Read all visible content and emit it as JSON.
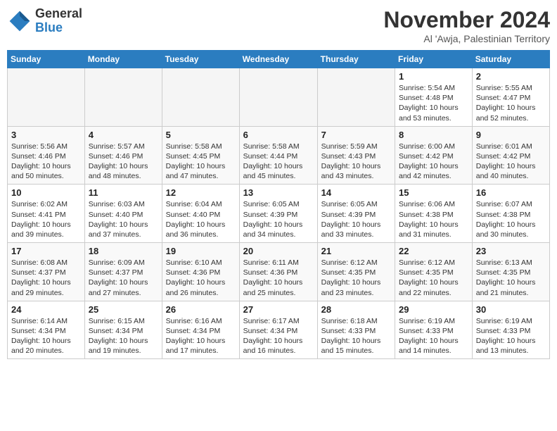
{
  "logo": {
    "line1": "General",
    "line2": "Blue"
  },
  "title": "November 2024",
  "location": "Al 'Awja, Palestinian Territory",
  "days_header": [
    "Sunday",
    "Monday",
    "Tuesday",
    "Wednesday",
    "Thursday",
    "Friday",
    "Saturday"
  ],
  "weeks": [
    [
      {
        "day": "",
        "info": ""
      },
      {
        "day": "",
        "info": ""
      },
      {
        "day": "",
        "info": ""
      },
      {
        "day": "",
        "info": ""
      },
      {
        "day": "",
        "info": ""
      },
      {
        "day": "1",
        "info": "Sunrise: 5:54 AM\nSunset: 4:48 PM\nDaylight: 10 hours\nand 53 minutes."
      },
      {
        "day": "2",
        "info": "Sunrise: 5:55 AM\nSunset: 4:47 PM\nDaylight: 10 hours\nand 52 minutes."
      }
    ],
    [
      {
        "day": "3",
        "info": "Sunrise: 5:56 AM\nSunset: 4:46 PM\nDaylight: 10 hours\nand 50 minutes."
      },
      {
        "day": "4",
        "info": "Sunrise: 5:57 AM\nSunset: 4:46 PM\nDaylight: 10 hours\nand 48 minutes."
      },
      {
        "day": "5",
        "info": "Sunrise: 5:58 AM\nSunset: 4:45 PM\nDaylight: 10 hours\nand 47 minutes."
      },
      {
        "day": "6",
        "info": "Sunrise: 5:58 AM\nSunset: 4:44 PM\nDaylight: 10 hours\nand 45 minutes."
      },
      {
        "day": "7",
        "info": "Sunrise: 5:59 AM\nSunset: 4:43 PM\nDaylight: 10 hours\nand 43 minutes."
      },
      {
        "day": "8",
        "info": "Sunrise: 6:00 AM\nSunset: 4:42 PM\nDaylight: 10 hours\nand 42 minutes."
      },
      {
        "day": "9",
        "info": "Sunrise: 6:01 AM\nSunset: 4:42 PM\nDaylight: 10 hours\nand 40 minutes."
      }
    ],
    [
      {
        "day": "10",
        "info": "Sunrise: 6:02 AM\nSunset: 4:41 PM\nDaylight: 10 hours\nand 39 minutes."
      },
      {
        "day": "11",
        "info": "Sunrise: 6:03 AM\nSunset: 4:40 PM\nDaylight: 10 hours\nand 37 minutes."
      },
      {
        "day": "12",
        "info": "Sunrise: 6:04 AM\nSunset: 4:40 PM\nDaylight: 10 hours\nand 36 minutes."
      },
      {
        "day": "13",
        "info": "Sunrise: 6:05 AM\nSunset: 4:39 PM\nDaylight: 10 hours\nand 34 minutes."
      },
      {
        "day": "14",
        "info": "Sunrise: 6:05 AM\nSunset: 4:39 PM\nDaylight: 10 hours\nand 33 minutes."
      },
      {
        "day": "15",
        "info": "Sunrise: 6:06 AM\nSunset: 4:38 PM\nDaylight: 10 hours\nand 31 minutes."
      },
      {
        "day": "16",
        "info": "Sunrise: 6:07 AM\nSunset: 4:38 PM\nDaylight: 10 hours\nand 30 minutes."
      }
    ],
    [
      {
        "day": "17",
        "info": "Sunrise: 6:08 AM\nSunset: 4:37 PM\nDaylight: 10 hours\nand 29 minutes."
      },
      {
        "day": "18",
        "info": "Sunrise: 6:09 AM\nSunset: 4:37 PM\nDaylight: 10 hours\nand 27 minutes."
      },
      {
        "day": "19",
        "info": "Sunrise: 6:10 AM\nSunset: 4:36 PM\nDaylight: 10 hours\nand 26 minutes."
      },
      {
        "day": "20",
        "info": "Sunrise: 6:11 AM\nSunset: 4:36 PM\nDaylight: 10 hours\nand 25 minutes."
      },
      {
        "day": "21",
        "info": "Sunrise: 6:12 AM\nSunset: 4:35 PM\nDaylight: 10 hours\nand 23 minutes."
      },
      {
        "day": "22",
        "info": "Sunrise: 6:12 AM\nSunset: 4:35 PM\nDaylight: 10 hours\nand 22 minutes."
      },
      {
        "day": "23",
        "info": "Sunrise: 6:13 AM\nSunset: 4:35 PM\nDaylight: 10 hours\nand 21 minutes."
      }
    ],
    [
      {
        "day": "24",
        "info": "Sunrise: 6:14 AM\nSunset: 4:34 PM\nDaylight: 10 hours\nand 20 minutes."
      },
      {
        "day": "25",
        "info": "Sunrise: 6:15 AM\nSunset: 4:34 PM\nDaylight: 10 hours\nand 19 minutes."
      },
      {
        "day": "26",
        "info": "Sunrise: 6:16 AM\nSunset: 4:34 PM\nDaylight: 10 hours\nand 17 minutes."
      },
      {
        "day": "27",
        "info": "Sunrise: 6:17 AM\nSunset: 4:34 PM\nDaylight: 10 hours\nand 16 minutes."
      },
      {
        "day": "28",
        "info": "Sunrise: 6:18 AM\nSunset: 4:33 PM\nDaylight: 10 hours\nand 15 minutes."
      },
      {
        "day": "29",
        "info": "Sunrise: 6:19 AM\nSunset: 4:33 PM\nDaylight: 10 hours\nand 14 minutes."
      },
      {
        "day": "30",
        "info": "Sunrise: 6:19 AM\nSunset: 4:33 PM\nDaylight: 10 hours\nand 13 minutes."
      }
    ]
  ]
}
